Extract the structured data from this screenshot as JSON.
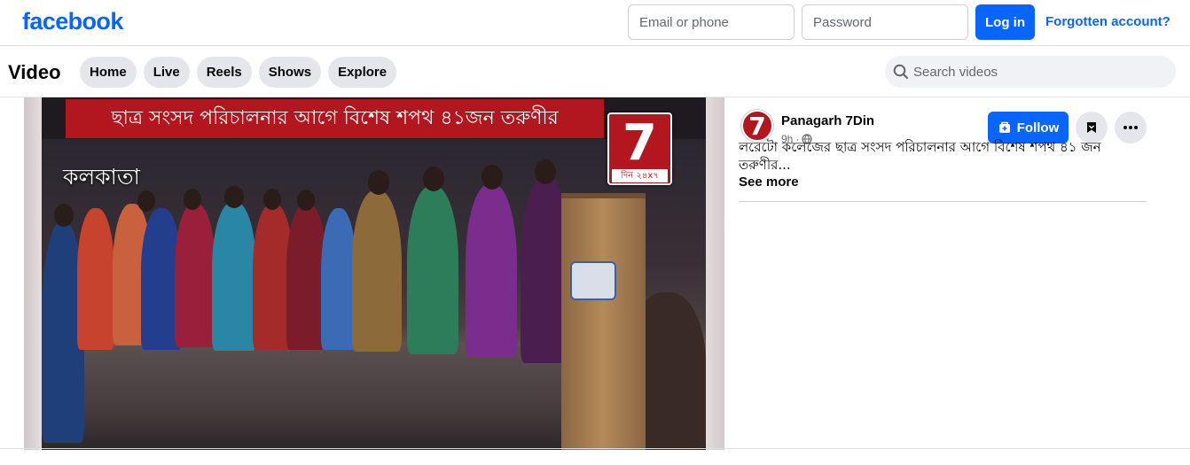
{
  "header": {
    "logo": "facebook",
    "email_placeholder": "Email or phone",
    "password_placeholder": "Password",
    "login_label": "Log in",
    "forgot_label": "Forgotten account?"
  },
  "video_nav": {
    "title": "Video",
    "tabs": [
      {
        "label": "Home"
      },
      {
        "label": "Live"
      },
      {
        "label": "Reels"
      },
      {
        "label": "Shows"
      },
      {
        "label": "Explore"
      }
    ],
    "search_placeholder": "Search videos"
  },
  "video": {
    "banner_text": "ছাত্র সংসদ পরিচালনার আগে বিশেষ শপথ ৪১জন তরুণীর",
    "city_text": "কলকাতা",
    "channel_badge_number": "7",
    "channel_badge_text": "দিন ২৪x৭"
  },
  "post": {
    "page_name": "Panagarh 7Din",
    "time": "9h",
    "avatar_text": "7",
    "follow_label": "Follow",
    "caption": "লরেটো কলেজের ছাত্র সংসদ পরিচালনার আগে বিশেষ শপথ ৪১ জন তরুণীর...",
    "see_more_label": "See more"
  },
  "colors": {
    "brand_blue": "#0866ff",
    "banner_red": "#b2161e"
  }
}
